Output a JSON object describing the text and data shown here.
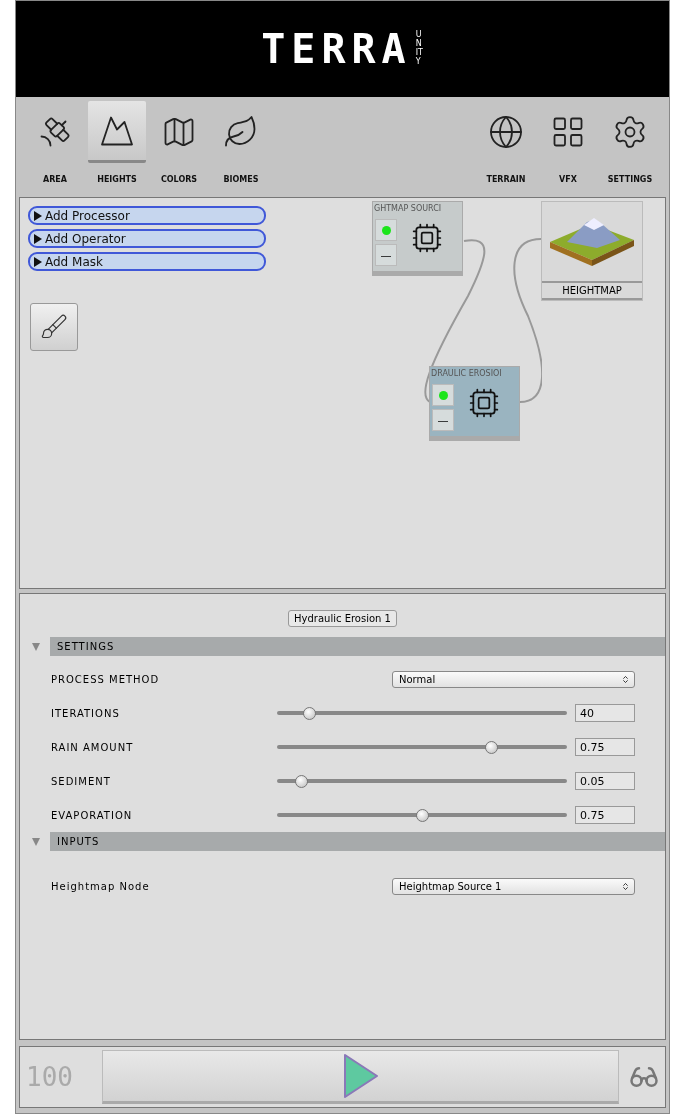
{
  "logo": {
    "title": "TERRA",
    "subtitle": "UNITY"
  },
  "tabs": {
    "left": [
      {
        "label": "AREA",
        "kind": "area",
        "selected": false
      },
      {
        "label": "HEIGHTS",
        "kind": "heights",
        "selected": true
      },
      {
        "label": "COLORS",
        "kind": "colors",
        "selected": false
      },
      {
        "label": "BIOMES",
        "kind": "biomes",
        "selected": false
      }
    ],
    "right": [
      {
        "label": "TERRAIN",
        "kind": "terrain",
        "selected": false
      },
      {
        "label": "VFX",
        "kind": "vfx",
        "selected": false
      },
      {
        "label": "SETTINGS",
        "kind": "settings",
        "selected": false
      }
    ]
  },
  "graph": {
    "add_buttons": [
      "Add Processor",
      "Add Operator",
      "Add Mask"
    ],
    "nodes": [
      {
        "title": "GHTMAP SOURCI",
        "selected": false,
        "on": true,
        "minus": "—"
      },
      {
        "title": "DRAULIC EROSIOI",
        "selected": true,
        "on": true,
        "minus": "—"
      }
    ],
    "output": {
      "label": "HEIGHTMAP"
    }
  },
  "inspector": {
    "node_name": "Hydraulic Erosion 1",
    "sections": [
      {
        "title": "SETTINGS",
        "expanded": true,
        "rows": [
          {
            "kind": "dropdown",
            "label": "PROCESS METHOD",
            "value": "Normal"
          },
          {
            "kind": "slider",
            "label": "ITERATIONS",
            "level": 0.09,
            "value": "40"
          },
          {
            "kind": "slider",
            "label": "RAIN AMOUNT",
            "level": 0.75,
            "value": "0.75"
          },
          {
            "kind": "slider",
            "label": "SEDIMENT",
            "level": 0.06,
            "value": "0.05"
          },
          {
            "kind": "slider",
            "label": "EVAPORATION",
            "level": 0.5,
            "value": "0.75"
          }
        ]
      },
      {
        "title": "INPUTS",
        "expanded": true,
        "rows": [
          {
            "kind": "dropdown",
            "label": "Heightmap Node",
            "value": "Heightmap Source 1"
          }
        ]
      }
    ]
  },
  "bottom_bar": {
    "counter": "100"
  }
}
